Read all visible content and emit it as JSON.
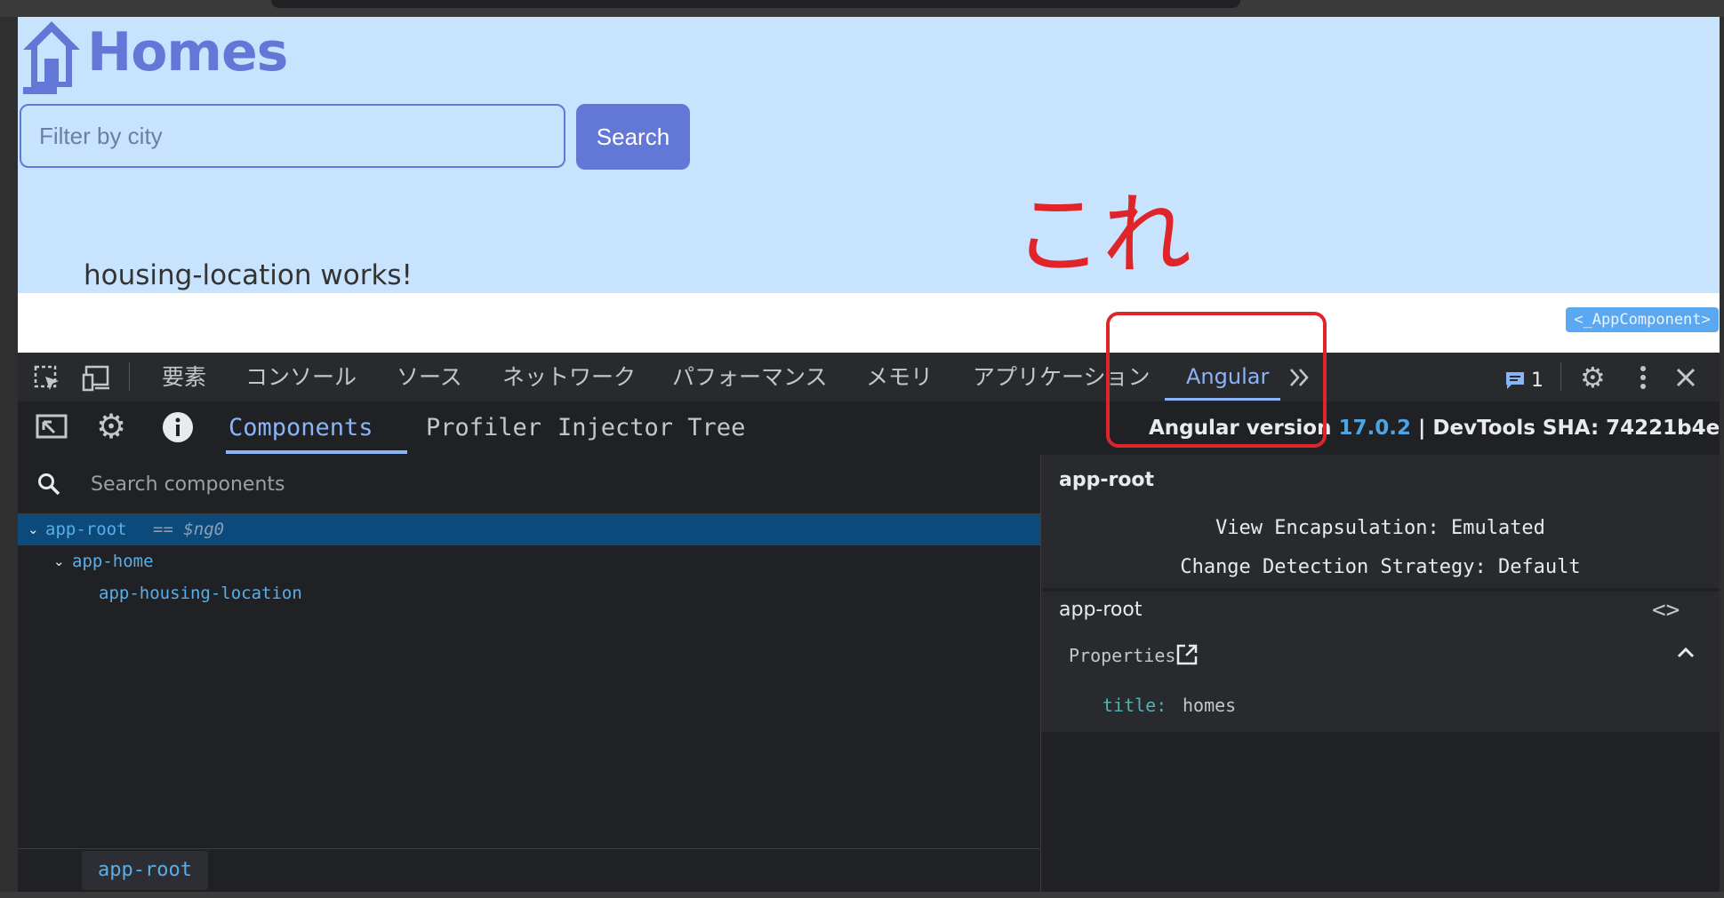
{
  "app": {
    "brand_title": "Homes",
    "filter_placeholder": "Filter by city",
    "search_label": "Search",
    "housing_text": "housing-location works!",
    "component_badge": "<_AppComponent>",
    "annotation": "これ"
  },
  "devtools": {
    "tabs": [
      "要素",
      "コンソール",
      "ソース",
      "ネットワーク",
      "パフォーマンス",
      "メモリ",
      "アプリケーション",
      "Angular"
    ],
    "more_icon": "chevron-double-right-icon",
    "issues_count": "1"
  },
  "angular": {
    "tabs": [
      "Components",
      "Profiler",
      "Injector Tree"
    ],
    "version_label": "Angular version",
    "version": "17.0.2",
    "separator": "|",
    "sha_label": "DevTools SHA: 74221b4e",
    "search_placeholder": "Search components",
    "tree": [
      {
        "name": "app-root",
        "suffix": "== $ng0"
      },
      {
        "name": "app-home"
      },
      {
        "name": "app-housing-location"
      }
    ],
    "breadcrumb": "app-root"
  },
  "details": {
    "title": "app-root",
    "view_encapsulation": "View Encapsulation: Emulated",
    "change_detection": "Change Detection Strategy: Default",
    "subtitle": "app-root",
    "properties_label": "Properties",
    "property_key": "title:",
    "property_value": "homes"
  },
  "colors": {
    "accent": "#6277d6",
    "app_bg": "#c8e3fd",
    "devtools_bg": "#202124",
    "selection": "#0b4a7a",
    "link": "#8ab4f8",
    "annotation_red": "#e0252a"
  }
}
